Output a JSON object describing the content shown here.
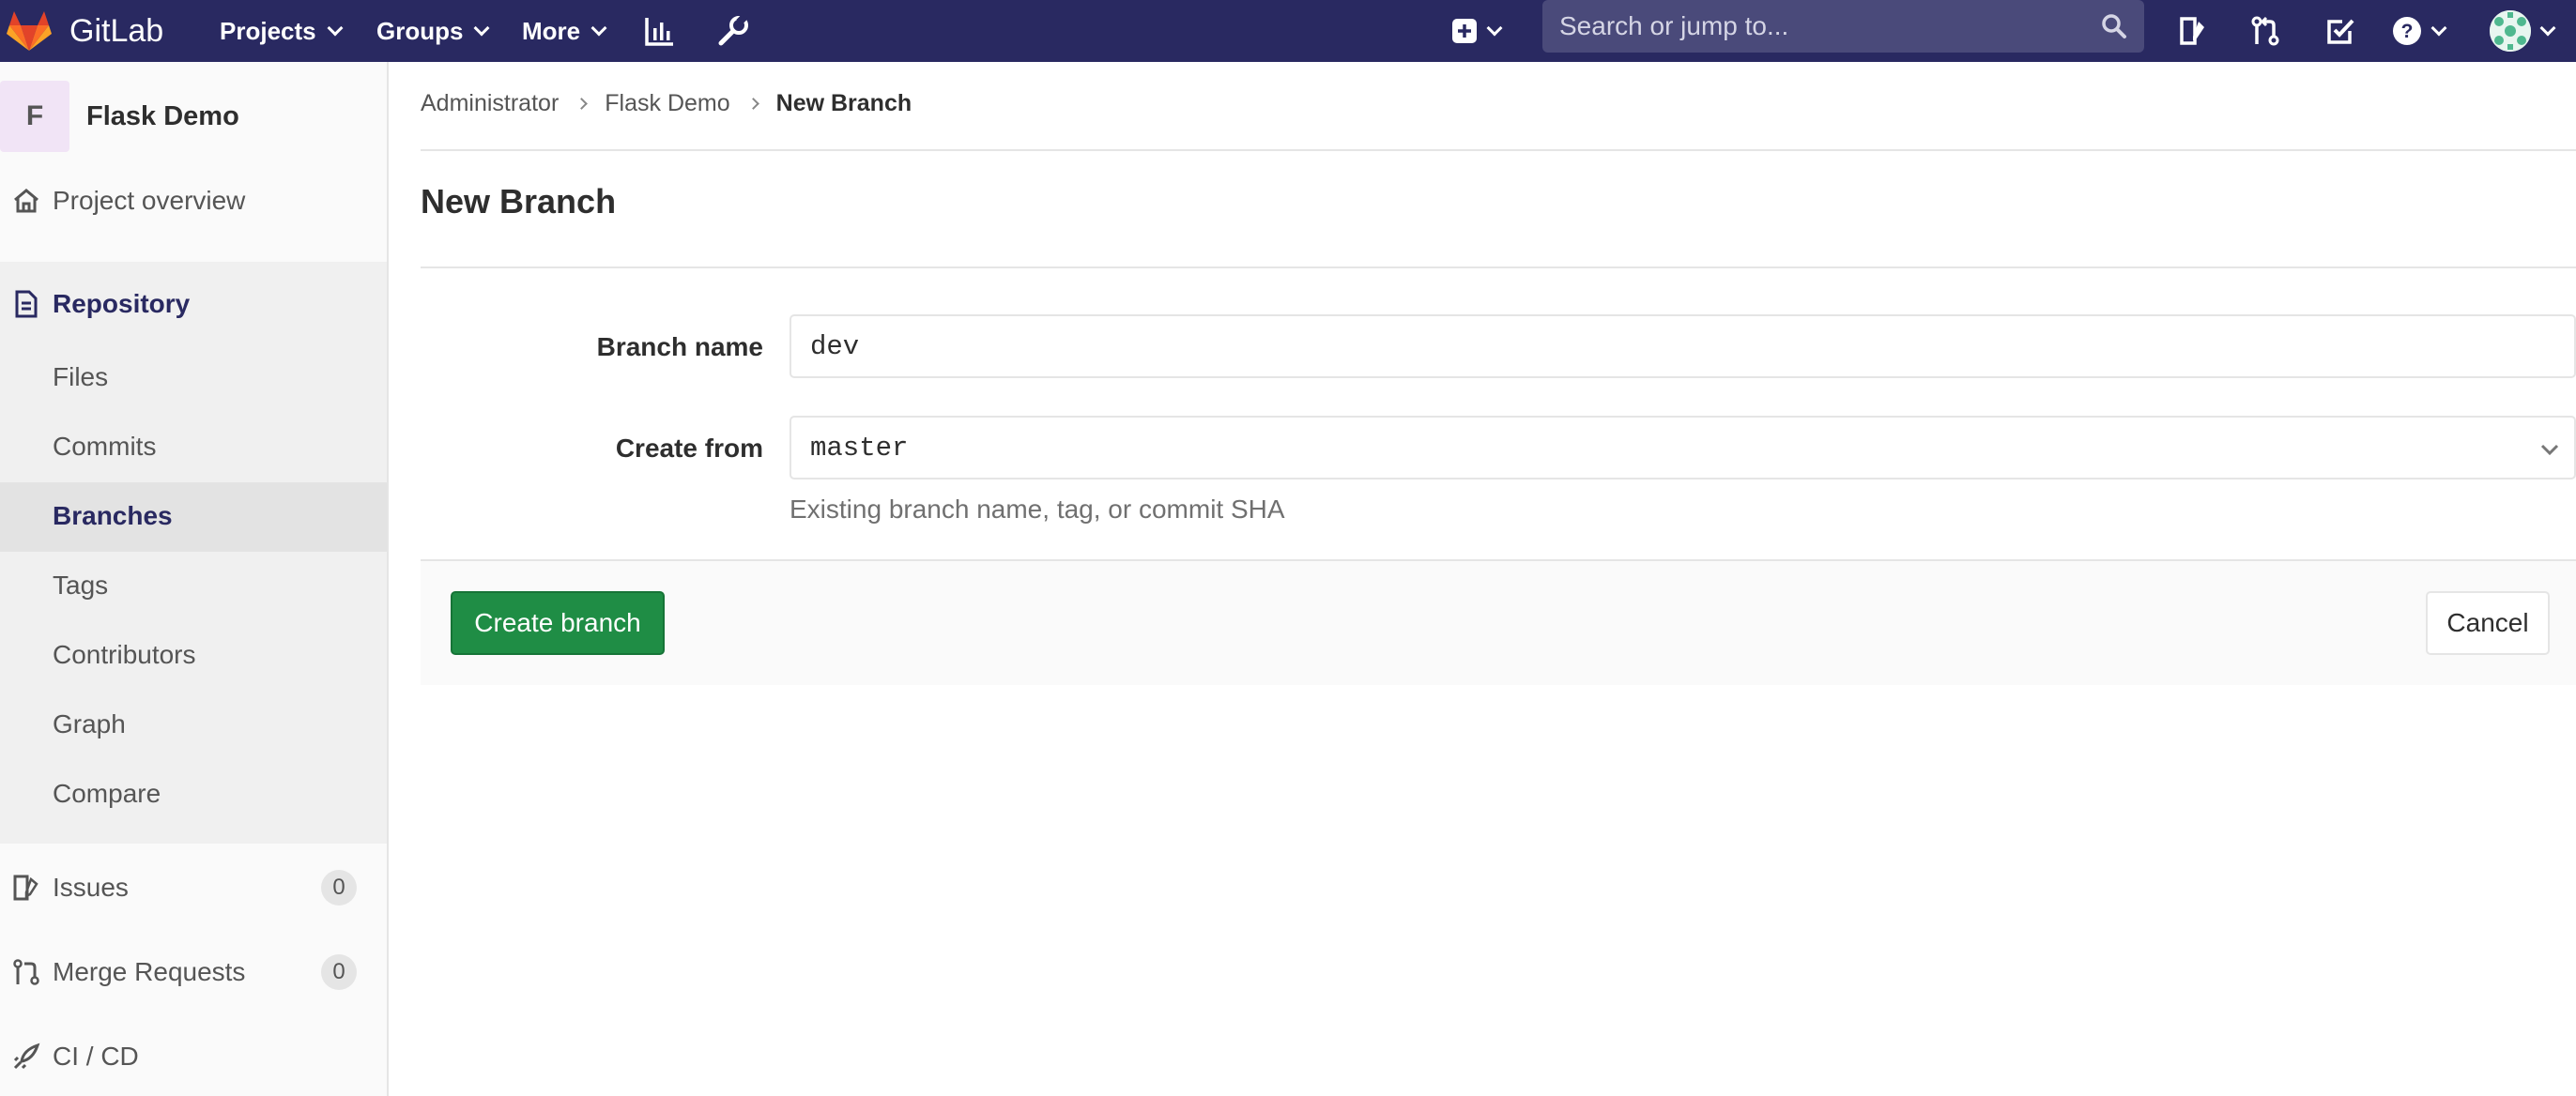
{
  "app": {
    "name": "GitLab"
  },
  "navbar": {
    "projects": "Projects",
    "groups": "Groups",
    "more": "More",
    "search_placeholder": "Search or jump to...",
    "icons": [
      "activity-chart-icon",
      "wrench-icon",
      "plus-square-icon",
      "issues-icon",
      "merge-request-icon",
      "todo-check-icon",
      "help-icon",
      "avatar"
    ]
  },
  "sidebar": {
    "project_initial": "F",
    "project_name": "Flask Demo",
    "overview": "Project overview",
    "repository": "Repository",
    "repo_items": [
      "Files",
      "Commits",
      "Branches",
      "Tags",
      "Contributors",
      "Graph",
      "Compare"
    ],
    "active_item": "Branches",
    "issues": {
      "label": "Issues",
      "count": "0"
    },
    "merge_requests": {
      "label": "Merge Requests",
      "count": "0"
    },
    "cicd": "CI / CD"
  },
  "breadcrumb": [
    "Administrator",
    "Flask Demo",
    "New Branch"
  ],
  "page": {
    "title": "New Branch",
    "branch_name_label": "Branch name",
    "branch_name_value": "dev",
    "create_from_label": "Create from",
    "create_from_value": "master",
    "help_text": "Existing branch name, tag, or commit SHA",
    "create_button": "Create branch",
    "cancel_button": "Cancel"
  },
  "colors": {
    "navbar": "#292961",
    "accent": "#292961",
    "success": "#1f8d45"
  }
}
